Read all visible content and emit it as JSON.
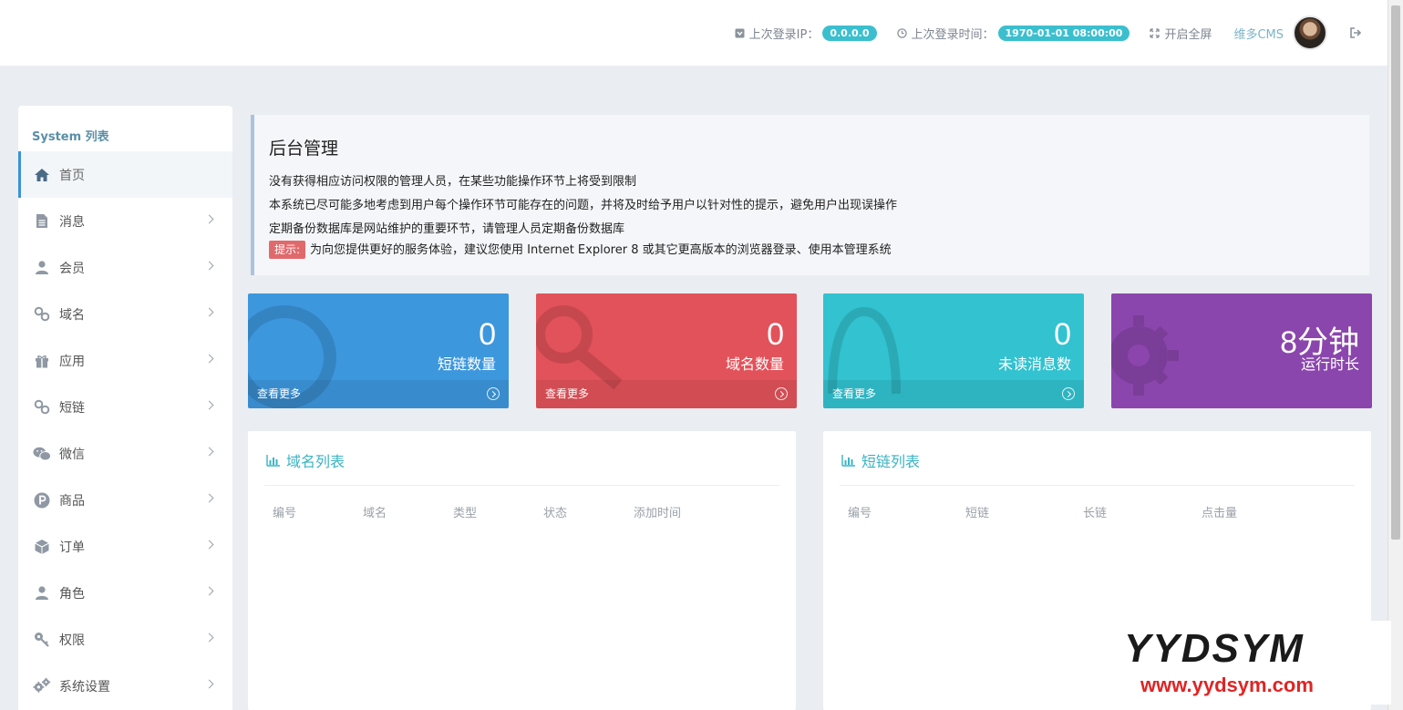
{
  "header": {
    "last_ip_label": "上次登录IP：",
    "last_ip_value": "0.0.0.0",
    "last_time_label": "上次登录时间：",
    "last_time_value": "1970-01-01 08:00:00",
    "fullscreen_label": "开启全屏",
    "user_name": "维多CMS",
    "icons": [
      "ip-icon",
      "clock-icon",
      "expand-icon",
      "avatar",
      "logout-icon"
    ]
  },
  "sidebar": {
    "title": "System 列表",
    "items": [
      {
        "label": "首页",
        "icon": "home-icon",
        "active": true
      },
      {
        "label": "消息",
        "icon": "document-icon"
      },
      {
        "label": "会员",
        "icon": "user-icon"
      },
      {
        "label": "域名",
        "icon": "link-icon"
      },
      {
        "label": "应用",
        "icon": "gift-icon"
      },
      {
        "label": "短链",
        "icon": "link-icon"
      },
      {
        "label": "微信",
        "icon": "wechat-icon"
      },
      {
        "label": "商品",
        "icon": "product-icon"
      },
      {
        "label": "订单",
        "icon": "cube-icon"
      },
      {
        "label": "角色",
        "icon": "user-icon"
      },
      {
        "label": "权限",
        "icon": "key-icon"
      },
      {
        "label": "系统设置",
        "icon": "gears-icon"
      }
    ]
  },
  "notice": {
    "title": "后台管理",
    "lines": [
      "没有获得相应访问权限的管理人员，在某些功能操作环节上将受到限制",
      "本系统已尽可能多地考虑到用户每个操作环节可能存在的问题，并将及时给予用户以针对性的提示，避免用户出现误操作",
      "定期备份数据库是网站维护的重要环节，请管理人员定期备份数据库"
    ],
    "tip_badge": "提示:",
    "tip_text": "为向您提供更好的服务体验，建议您使用 Internet Explorer 8 或其它更高版本的浏览器登录、使用本管理系统"
  },
  "stats": [
    {
      "value": "0",
      "label": "短链数量",
      "more": "查看更多",
      "color": "#3d97dd",
      "icon": "compass-icon"
    },
    {
      "value": "0",
      "label": "域名数量",
      "more": "查看更多",
      "color": "#e2525a",
      "icon": "key-icon"
    },
    {
      "value": "0",
      "label": "未读消息数",
      "more": "查看更多",
      "color": "#32c2d0",
      "icon": "bell-icon"
    },
    {
      "value": "8分钟",
      "label": "运行时长",
      "color": "#8b46ad",
      "icon": "gear-icon"
    }
  ],
  "domain_panel": {
    "title": "域名列表",
    "columns": [
      "编号",
      "域名",
      "类型",
      "状态",
      "添加时间"
    ]
  },
  "link_panel": {
    "title": "短链列表",
    "columns": [
      "编号",
      "短链",
      "长链",
      "点击量"
    ]
  },
  "watermark": {
    "text": "YYDSYM",
    "url": "www.yydsym.com"
  }
}
